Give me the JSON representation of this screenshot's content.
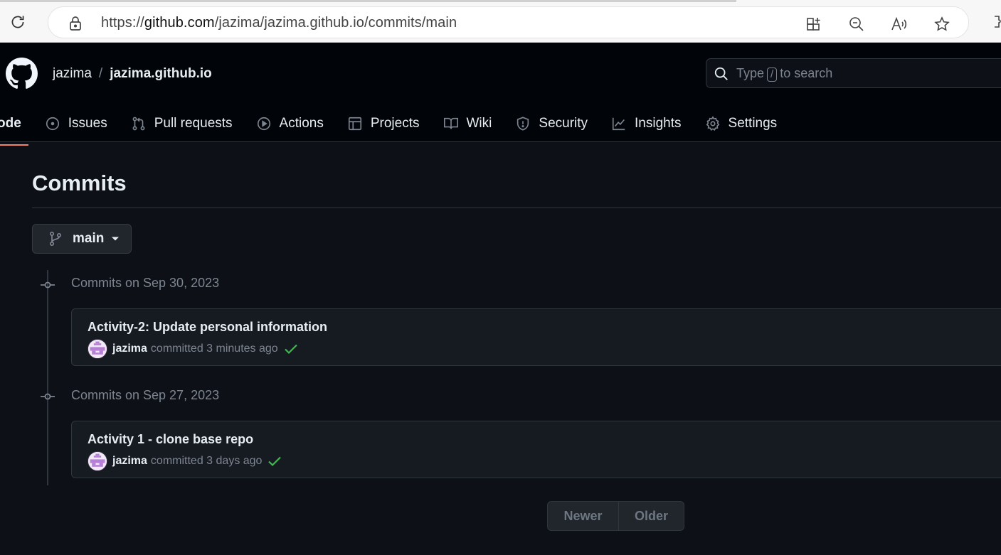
{
  "browser": {
    "url_prefix": "https://",
    "url_host": "github.com",
    "url_path": "/jazima/jazima.github.io/commits/main"
  },
  "header": {
    "owner": "jazima",
    "separator": "/",
    "repo": "jazima.github.io",
    "search": {
      "type_label": "Type",
      "key": "/",
      "to_search_label": "to search"
    }
  },
  "tabs": [
    {
      "label": "ode",
      "icon": "code-icon"
    },
    {
      "label": "Issues",
      "icon": "issue-icon"
    },
    {
      "label": "Pull requests",
      "icon": "pull-request-icon"
    },
    {
      "label": "Actions",
      "icon": "play-icon"
    },
    {
      "label": "Projects",
      "icon": "table-icon"
    },
    {
      "label": "Wiki",
      "icon": "book-icon"
    },
    {
      "label": "Security",
      "icon": "shield-icon"
    },
    {
      "label": "Insights",
      "icon": "graph-icon"
    },
    {
      "label": "Settings",
      "icon": "gear-icon"
    }
  ],
  "main": {
    "title": "Commits",
    "branch": "main",
    "groups": [
      {
        "heading": "Commits on Sep 30, 2023",
        "commit": {
          "message": "Activity-2: Update personal information",
          "author": "jazima",
          "action": "committed",
          "time": "3 minutes ago",
          "status": "success"
        }
      },
      {
        "heading": "Commits on Sep 27, 2023",
        "commit": {
          "message": "Activity 1 - clone base repo",
          "author": "jazima",
          "action": "committed",
          "time": "3 days ago",
          "status": "success"
        }
      }
    ],
    "pager": {
      "newer": "Newer",
      "older": "Older"
    }
  },
  "colors": {
    "accent_underline": "#f78166",
    "success": "#3fb950",
    "background": "#0d1117",
    "header_bg": "#010409"
  }
}
